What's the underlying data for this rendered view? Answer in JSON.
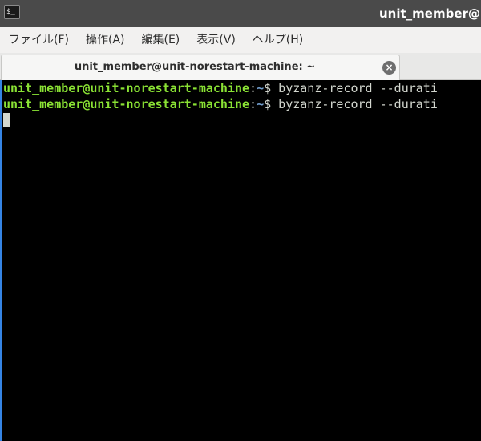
{
  "window": {
    "icon_glyph": "$_",
    "title": "unit_member@u"
  },
  "menubar": {
    "items": [
      {
        "label": "ファイル(F)"
      },
      {
        "label": "操作(A)"
      },
      {
        "label": "編集(E)"
      },
      {
        "label": "表示(V)"
      },
      {
        "label": "ヘルプ(H)"
      }
    ]
  },
  "tabs": [
    {
      "label": "unit_member@unit-norestart-machine: ~",
      "close_icon": "close-icon",
      "active": true
    }
  ],
  "terminal": {
    "lines": [
      {
        "user_host": "unit_member@unit-norestart-machine",
        "colon": ":",
        "path": "~",
        "dollar": "$ ",
        "command": "byzanz-record --durati"
      },
      {
        "user_host": "unit_member@unit-norestart-machine",
        "colon": ":",
        "path": "~",
        "dollar": "$ ",
        "command": "byzanz-record --durati"
      }
    ]
  },
  "colors": {
    "titlebar_bg": "#4a4a4a",
    "menubar_bg": "#f2f1f0",
    "terminal_bg": "#000000",
    "prompt_user": "#8ae234",
    "prompt_path": "#729fcf",
    "terminal_fg": "#d3d7cf",
    "focus_border": "#3584e4"
  }
}
